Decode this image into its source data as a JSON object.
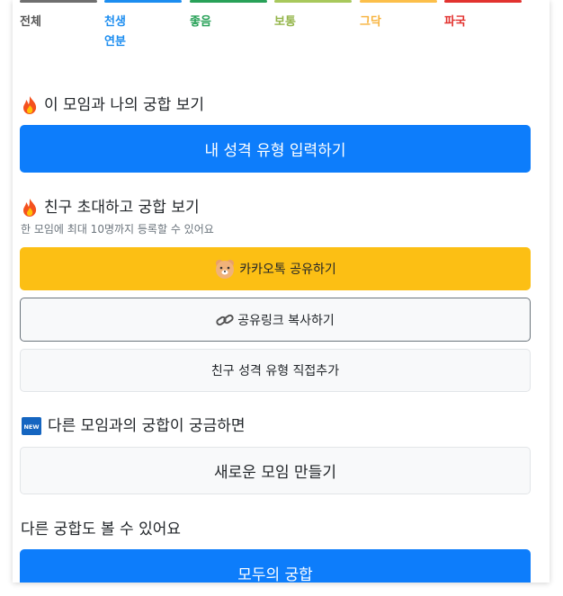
{
  "legend": [
    {
      "label": "전체",
      "color": "#6f6f6f"
    },
    {
      "label": "천생\n연분",
      "color": "#1c8df0"
    },
    {
      "label": "좋음",
      "color": "#28a158"
    },
    {
      "label": "보통",
      "color": "#a8c85c"
    },
    {
      "label": "그닥",
      "color": "#fcbf4a"
    },
    {
      "label": "파국",
      "color": "#e2322f"
    }
  ],
  "sections": {
    "my_match": {
      "title": "이 모임과 나의 궁합 보기",
      "button": "내 성격 유형 입력하기",
      "icon": "fire-icon"
    },
    "invite": {
      "title": "친구 초대하고 궁합 보기",
      "subtitle": "한 모임에 최대 10명까지 등록할 수 있어요",
      "icon": "fire-icon",
      "kakao_button": "카카오톡 공유하기",
      "copy_link_button": "공유링크 복사하기",
      "add_friend_button": "친구 성격 유형 직접추가"
    },
    "other_group": {
      "title": "다른 모임과의 궁합이 궁금하면",
      "button": "새로운 모임 만들기",
      "icon": "new-badge-icon",
      "badge_text": "NEW"
    },
    "more": {
      "title": "다른 궁합도 볼 수 있어요",
      "button": "모두의 궁합"
    }
  },
  "colors": {
    "primary": "#0d7dfb",
    "kakao": "#fcbf14"
  }
}
